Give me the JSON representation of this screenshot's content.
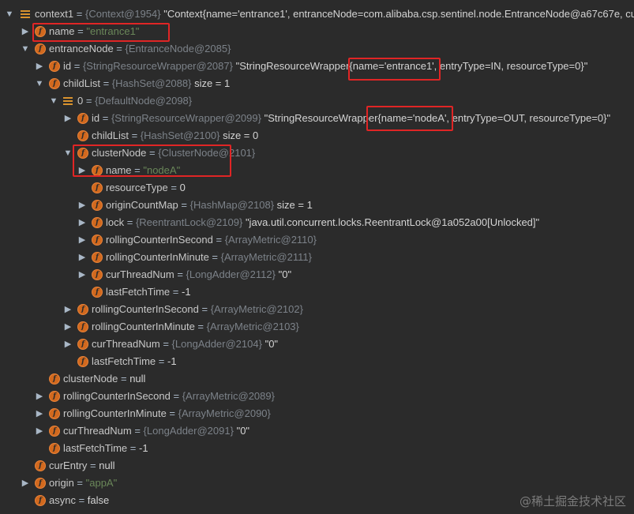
{
  "tree": [
    {
      "arrow": "down",
      "icon": "list",
      "name": "context1",
      "ref": "{Context@1954}",
      "val": "\"Context{name='entrance1', entranceNode=com.alibaba.csp.sentinel.node.EntranceNode@a67c67e, cu"
    },
    {
      "arrow": "right",
      "icon": "f",
      "name": "name",
      "str": "\"entrance1\""
    },
    {
      "arrow": "down",
      "icon": "f",
      "name": "entranceNode",
      "ref": "{EntranceNode@2085}"
    },
    {
      "arrow": "right",
      "icon": "f",
      "name": "id",
      "ref": "{StringResourceWrapper@2087}",
      "val": "\"StringResourceWrapper{name='entrance1', entryType=IN, resourceType=0}\""
    },
    {
      "arrow": "down",
      "icon": "f",
      "name": "childList",
      "ref": "{HashSet@2088}",
      "val": " size = 1"
    },
    {
      "arrow": "down",
      "icon": "list",
      "name": "0",
      "ref": "{DefaultNode@2098}"
    },
    {
      "arrow": "right",
      "icon": "f",
      "name": "id",
      "ref": "{StringResourceWrapper@2099}",
      "val": "\"StringResourceWrapper{name='nodeA', entryType=OUT, resourceType=0}\""
    },
    {
      "arrow": "",
      "icon": "f",
      "name": "childList",
      "ref": "{HashSet@2100}",
      "val": " size = 0"
    },
    {
      "arrow": "down",
      "icon": "f",
      "name": "clusterNode",
      "ref": "{ClusterNode@2101}"
    },
    {
      "arrow": "right",
      "icon": "f",
      "name": "name",
      "str": "\"nodeA\""
    },
    {
      "arrow": "",
      "icon": "f",
      "name": "resourceType",
      "val": "0"
    },
    {
      "arrow": "right",
      "icon": "f",
      "name": "originCountMap",
      "ref": "{HashMap@2108}",
      "val": " size = 1"
    },
    {
      "arrow": "right",
      "icon": "f",
      "name": "lock",
      "ref": "{ReentrantLock@2109}",
      "val": "\"java.util.concurrent.locks.ReentrantLock@1a052a00[Unlocked]\""
    },
    {
      "arrow": "right",
      "icon": "f",
      "name": "rollingCounterInSecond",
      "ref": "{ArrayMetric@2110}"
    },
    {
      "arrow": "right",
      "icon": "f",
      "name": "rollingCounterInMinute",
      "ref": "{ArrayMetric@2111}"
    },
    {
      "arrow": "right",
      "icon": "f",
      "name": "curThreadNum",
      "ref": "{LongAdder@2112}",
      "val": "\"0\""
    },
    {
      "arrow": "",
      "icon": "f",
      "name": "lastFetchTime",
      "val": "-1"
    },
    {
      "arrow": "right",
      "icon": "f",
      "name": "rollingCounterInSecond",
      "ref": "{ArrayMetric@2102}"
    },
    {
      "arrow": "right",
      "icon": "f",
      "name": "rollingCounterInMinute",
      "ref": "{ArrayMetric@2103}"
    },
    {
      "arrow": "right",
      "icon": "f",
      "name": "curThreadNum",
      "ref": "{LongAdder@2104}",
      "val": "\"0\""
    },
    {
      "arrow": "",
      "icon": "f",
      "name": "lastFetchTime",
      "val": "-1"
    },
    {
      "arrow": "",
      "icon": "f",
      "name": "clusterNode",
      "val": "null"
    },
    {
      "arrow": "right",
      "icon": "f",
      "name": "rollingCounterInSecond",
      "ref": "{ArrayMetric@2089}"
    },
    {
      "arrow": "right",
      "icon": "f",
      "name": "rollingCounterInMinute",
      "ref": "{ArrayMetric@2090}"
    },
    {
      "arrow": "right",
      "icon": "f",
      "name": "curThreadNum",
      "ref": "{LongAdder@2091}",
      "val": "\"0\""
    },
    {
      "arrow": "",
      "icon": "f",
      "name": "lastFetchTime",
      "val": "-1"
    },
    {
      "arrow": "",
      "icon": "f",
      "name": "curEntry",
      "val": "null"
    },
    {
      "arrow": "right",
      "icon": "f",
      "name": "origin",
      "str": "\"appA\""
    },
    {
      "arrow": "",
      "icon": "f",
      "name": "async",
      "val": "false"
    }
  ],
  "watermark": "@稀土掘金技术社区",
  "colors": {
    "highlight": "#e02525",
    "field_icon": "#d2691e",
    "string": "#6a8759",
    "ref": "#7c8289"
  }
}
